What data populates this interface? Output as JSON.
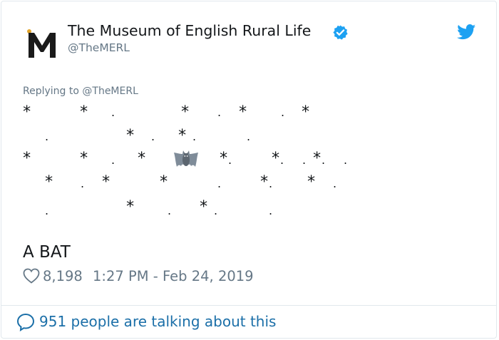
{
  "tweet": {
    "display_name": "The Museum of English Rural Life",
    "handle": "@TheMERL",
    "reply_prefix": "Replying to ",
    "reply_to": "@TheMERL",
    "star_char": "*",
    "dot_char": ".",
    "caption": "A BAT",
    "likes": "8,198",
    "timestamp": "1:27 PM - Feb 24, 2019",
    "talking": "951 people are talking about this"
  },
  "icons": {
    "avatar": "merl-m-logo",
    "verified": "verified-badge-icon",
    "brand": "twitter-bird-icon",
    "bat": "bat-emoji-icon",
    "like": "heart-icon",
    "reply": "speech-bubble-icon"
  },
  "colors": {
    "text": "#14171a",
    "secondary": "#657786",
    "accent": "#1da1f2",
    "link": "#1b6fa8",
    "border": "#e1e8ed"
  }
}
